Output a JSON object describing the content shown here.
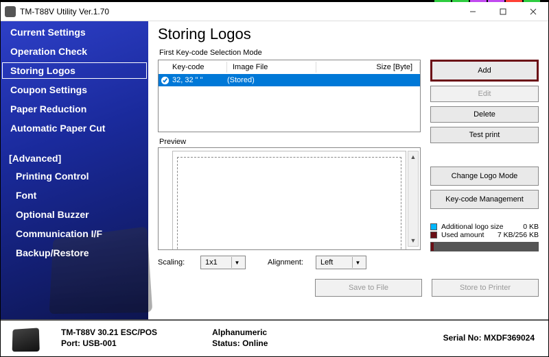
{
  "window": {
    "title": "TM-T88V Utility Ver.1.70"
  },
  "sidebar": {
    "items": [
      {
        "label": "Current Settings",
        "selected": false
      },
      {
        "label": "Operation Check",
        "selected": false
      },
      {
        "label": "Storing Logos",
        "selected": true
      },
      {
        "label": "Coupon Settings",
        "selected": false
      },
      {
        "label": "Paper Reduction",
        "selected": false
      },
      {
        "label": "Automatic Paper Cut",
        "selected": false
      }
    ],
    "advanced_label": "[Advanced]",
    "advanced_items": [
      {
        "label": "Printing Control"
      },
      {
        "label": "Font"
      },
      {
        "label": "Optional Buzzer"
      },
      {
        "label": "Communication I/F"
      },
      {
        "label": "Backup/Restore"
      }
    ]
  },
  "main": {
    "heading": "Storing Logos",
    "mode_label": "First Key-code Selection Mode",
    "list": {
      "col_keycode": "Key-code",
      "col_imagefile": "Image File",
      "col_size": "Size [Byte]",
      "rows": [
        {
          "keycode": "32, 32  \" \"",
          "imagefile": "(Stored)",
          "size": ""
        }
      ]
    },
    "preview_label": "Preview",
    "scaling_label": "Scaling:",
    "scaling_value": "1x1",
    "alignment_label": "Alignment:",
    "alignment_value": "Left",
    "buttons": {
      "add": "Add",
      "edit": "Edit",
      "delete": "Delete",
      "test_print": "Test print",
      "change_logo_mode": "Change Logo Mode",
      "keycode_management": "Key-code Management",
      "save_to_file": "Save to File",
      "store_to_printer": "Store to Printer"
    },
    "storage": {
      "additional_label": "Additional logo size",
      "additional_value": "0 KB",
      "used_label": "Used amount",
      "used_value": "7 KB/256 KB"
    }
  },
  "status": {
    "model": "TM-T88V 30.21 ESC/POS",
    "port_label": "Port:",
    "port_value": "USB-001",
    "mode": "Alphanumeric",
    "status_label": "Status:",
    "status_value": "Online",
    "serial_label": "Serial No:",
    "serial_value": "MXDF369024"
  }
}
